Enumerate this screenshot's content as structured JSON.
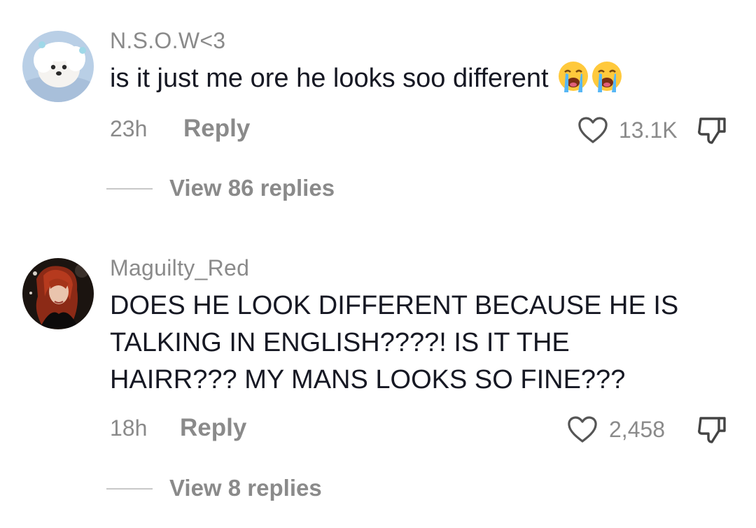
{
  "comments": [
    {
      "username": "N.S.O.W<3",
      "text": "is it just me ore he looks soo different",
      "emojis": [
        "loudly-crying-face-emoji",
        "loudly-crying-face-emoji"
      ],
      "time": "23h",
      "reply_label": "Reply",
      "likes": "13.1K",
      "view_replies": "View 86 replies",
      "avatar": "white-dog-avatar"
    },
    {
      "username": "Maguilty_Red",
      "text_lines": [
        "DOES HE LOOK DIFFERENT BECAUSE HE IS",
        "TALKING IN ENGLISH????! IS IT THE",
        "HAIRR??? MY MANS LOOKS SO FINE???"
      ],
      "time": "18h",
      "reply_label": "Reply",
      "likes": "2,458",
      "view_replies": "View 8 replies",
      "avatar": "red-hair-character-avatar"
    }
  ],
  "icons": {
    "like": "heart-outline-icon",
    "dislike": "thumbs-down-icon"
  },
  "colors": {
    "primary_text": "#161823",
    "secondary_text": "#8a8a8a",
    "divider": "#c8c8c8",
    "background": "#ffffff"
  }
}
